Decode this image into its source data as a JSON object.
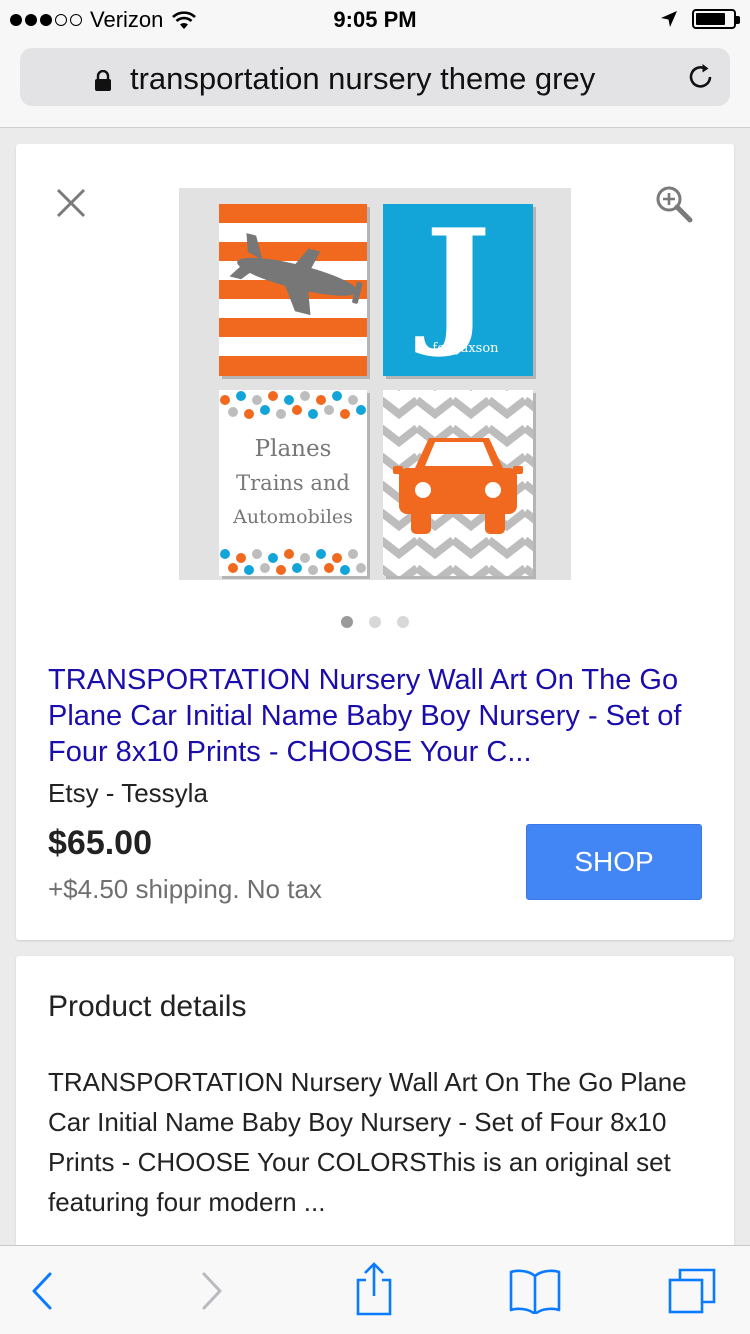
{
  "status_bar": {
    "carrier": "Verizon",
    "time": "9:05 PM",
    "signal_bars_filled": 3,
    "signal_bars_total": 5,
    "battery_level": 0.8
  },
  "browser": {
    "url_text": "transportation nursery theme grey"
  },
  "product": {
    "image_letter": "J",
    "image_caption": "is for Jaxson",
    "image_text_lines": [
      "Planes",
      "Trains and",
      "Automobiles"
    ],
    "carousel_pages": 3,
    "carousel_active": 1,
    "title": "TRANSPORTATION Nursery Wall Art On The Go Plane Car Initial Name Baby Boy Nursery - Set of Four 8x10 Prints - CHOOSE Your C...",
    "seller": "Etsy - Tessyla",
    "price": "$65.00",
    "shipping": "+$4.50 shipping. No tax",
    "shop_label": "SHOP"
  },
  "details": {
    "heading": "Product details",
    "body": "TRANSPORTATION Nursery Wall Art On The Go Plane Car Initial Name Baby Boy Nursery - Set of Four 8x10 Prints - CHOOSE Your COLORSThis is an original set featuring four modern ..."
  },
  "colors": {
    "link": "#1a0dab",
    "shop_button": "#4285f4",
    "ios_blue": "#0a7aff",
    "print_orange": "#f0691e",
    "print_blue": "#14a5d8",
    "print_grey": "#777777"
  },
  "icons": {
    "close": "close-icon",
    "zoom": "zoom-in-icon",
    "lock": "lock-icon",
    "reload": "reload-icon",
    "back": "back-icon",
    "forward": "forward-icon",
    "share": "share-icon",
    "bookmarks": "bookmarks-icon",
    "tabs": "tabs-icon"
  }
}
